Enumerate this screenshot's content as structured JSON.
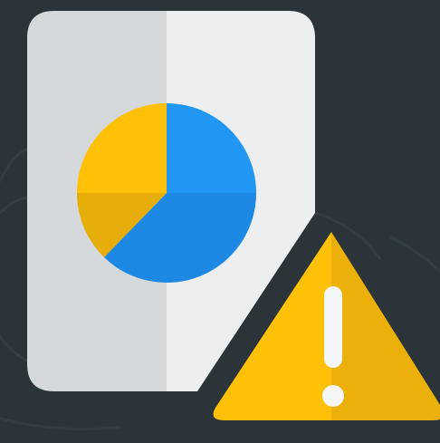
{
  "icon": {
    "name": "chart-document-warning-icon",
    "document_name": "document-icon",
    "chart_name": "pie-chart-icon",
    "warning_name": "warning-icon"
  },
  "colors": {
    "background": "#2b3539",
    "background_pattern": "#3a4549",
    "document_left": "#d6d9dc",
    "document_right": "#eceef0",
    "pie_blue_light": "#2196f3",
    "pie_blue_dark": "#1e88e5",
    "pie_yellow_light": "#ffc107",
    "pie_yellow_dark": "#e6ad0b",
    "warning_light": "#ffc107",
    "warning_dark": "#ebb10a",
    "warning_mark": "#f4f6f8"
  }
}
